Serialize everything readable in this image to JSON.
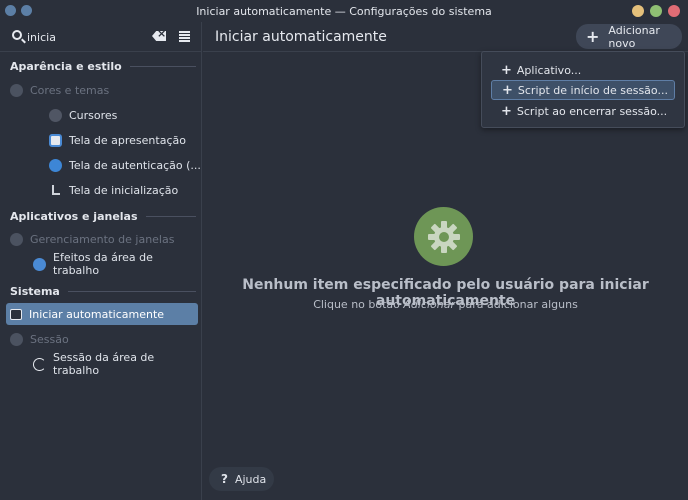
{
  "window": {
    "title": "Iniciar automaticamente — Configurações do sistema",
    "colors": {
      "minimize": "#e5c07b",
      "maximize": "#8fbf73",
      "close": "#e06c75",
      "background": "#2b303b",
      "accent": "#5c7fa6"
    }
  },
  "search": {
    "value": "inicia",
    "placeholder": ""
  },
  "sidebar": {
    "sections": [
      {
        "title": "Aparência e estilo"
      },
      {
        "title": "Aplicativos e janelas"
      },
      {
        "title": "Sistema"
      }
    ],
    "items": [
      {
        "label": "Cores e temas",
        "icon": "palette-icon"
      },
      {
        "label": "Cursores",
        "icon": "cursor-icon"
      },
      {
        "label": "Tela de apresentação",
        "icon": "splash-screen-icon"
      },
      {
        "label": "Tela de autenticação (...",
        "icon": "login-screen-icon"
      },
      {
        "label": "Tela de inicialização",
        "icon": "boot-screen-icon"
      },
      {
        "label": "Gerenciamento de janelas",
        "icon": "window-management-icon"
      },
      {
        "label": "Efeitos da área de trabalho",
        "icon": "desktop-effects-icon"
      },
      {
        "label": "Iniciar automaticamente",
        "icon": "autostart-icon"
      },
      {
        "label": "Sessão",
        "icon": "session-icon"
      },
      {
        "label": "Sessão da área de trabalho",
        "icon": "desktop-session-icon"
      }
    ]
  },
  "help": {
    "label": "Ajuda"
  },
  "main": {
    "title": "Iniciar automaticamente",
    "add_button": "Adicionar novo",
    "menu": [
      {
        "label": "Aplicativo..."
      },
      {
        "label": "Script de início de sessão..."
      },
      {
        "label": "Script ao encerrar sessão..."
      }
    ],
    "empty": {
      "title": "Nenhum item especificado pelo usuário para iniciar automaticamente",
      "sub_prefix": "Clique no botão ",
      "sub_em": "Adicionar",
      "sub_suffix": " para adicionar alguns"
    }
  }
}
